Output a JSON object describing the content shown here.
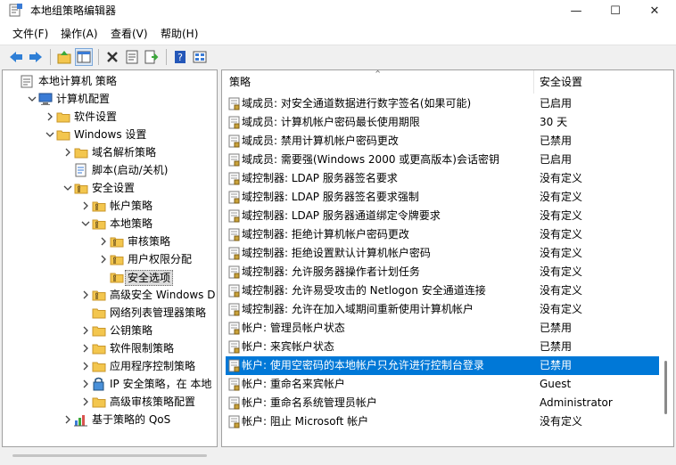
{
  "window": {
    "title": "本地组策略编辑器",
    "buttons": {
      "minimize": "—",
      "maximize": "☐",
      "close": "✕"
    }
  },
  "menu": [
    "文件(F)",
    "操作(A)",
    "查看(V)",
    "帮助(H)"
  ],
  "toolbar": [
    "back-icon",
    "forward-icon",
    "up-icon",
    "show-hide-tree-icon",
    "delete-icon",
    "properties-icon",
    "export-icon",
    "help-icon",
    "view-icon"
  ],
  "tree": [
    {
      "label": "本地计算机 策略",
      "level": 0,
      "icon": "computer-policy-icon",
      "expander": "none"
    },
    {
      "label": "计算机配置",
      "level": 1,
      "icon": "computer-icon",
      "expander": "open"
    },
    {
      "label": "软件设置",
      "level": 2,
      "icon": "folder-icon",
      "expander": "closed"
    },
    {
      "label": "Windows 设置",
      "level": 2,
      "icon": "folder-icon",
      "expander": "open"
    },
    {
      "label": "域名解析策略",
      "level": 3,
      "icon": "folder-icon",
      "expander": "closed"
    },
    {
      "label": "脚本(启动/关机)",
      "level": 3,
      "icon": "script-icon",
      "expander": "none"
    },
    {
      "label": "安全设置",
      "level": 3,
      "icon": "security-folder-icon",
      "expander": "open"
    },
    {
      "label": "帐户策略",
      "level": 4,
      "icon": "security-folder-icon",
      "expander": "closed"
    },
    {
      "label": "本地策略",
      "level": 4,
      "icon": "security-folder-icon",
      "expander": "open"
    },
    {
      "label": "审核策略",
      "level": 5,
      "icon": "security-folder-icon",
      "expander": "closed"
    },
    {
      "label": "用户权限分配",
      "level": 5,
      "icon": "security-folder-icon",
      "expander": "closed"
    },
    {
      "label": "安全选项",
      "level": 5,
      "icon": "security-folder-icon",
      "expander": "none",
      "selected": true
    },
    {
      "label": "高级安全 Windows D",
      "level": 4,
      "icon": "security-folder-icon",
      "expander": "closed"
    },
    {
      "label": "网络列表管理器策略",
      "level": 4,
      "icon": "folder-icon",
      "expander": "none"
    },
    {
      "label": "公钥策略",
      "level": 4,
      "icon": "folder-icon",
      "expander": "closed"
    },
    {
      "label": "软件限制策略",
      "level": 4,
      "icon": "folder-icon",
      "expander": "closed"
    },
    {
      "label": "应用程序控制策略",
      "level": 4,
      "icon": "folder-icon",
      "expander": "closed"
    },
    {
      "label": "IP 安全策略，在 本地",
      "level": 4,
      "icon": "ip-security-icon",
      "expander": "closed"
    },
    {
      "label": "高级审核策略配置",
      "level": 4,
      "icon": "folder-icon",
      "expander": "closed"
    },
    {
      "label": "基于策略的 QoS",
      "level": 3,
      "icon": "qos-chart-icon",
      "expander": "closed"
    }
  ],
  "list": {
    "columns": {
      "policy": "策略",
      "setting": "安全设置"
    },
    "rows": [
      {
        "name": "域成员: 对安全通道数据进行数字签名(如果可能)",
        "value": "已启用"
      },
      {
        "name": "域成员: 计算机帐户密码最长使用期限",
        "value": "30 天"
      },
      {
        "name": "域成员: 禁用计算机帐户密码更改",
        "value": "已禁用"
      },
      {
        "name": "域成员: 需要强(Windows 2000 或更高版本)会话密钥",
        "value": "已启用"
      },
      {
        "name": "域控制器: LDAP 服务器签名要求",
        "value": "没有定义"
      },
      {
        "name": "域控制器: LDAP 服务器签名要求强制",
        "value": "没有定义"
      },
      {
        "name": "域控制器: LDAP 服务器通道绑定令牌要求",
        "value": "没有定义"
      },
      {
        "name": "域控制器: 拒绝计算机帐户密码更改",
        "value": "没有定义"
      },
      {
        "name": "域控制器:  拒绝设置默认计算机帐户密码",
        "value": "没有定义"
      },
      {
        "name": "域控制器: 允许服务器操作者计划任务",
        "value": "没有定义"
      },
      {
        "name": "域控制器: 允许易受攻击的 Netlogon 安全通道连接",
        "value": "没有定义"
      },
      {
        "name": "域控制器:  允许在加入域期间重新使用计算机帐户",
        "value": "没有定义"
      },
      {
        "name": "帐户: 管理员帐户状态",
        "value": "已禁用"
      },
      {
        "name": "帐户: 来宾帐户状态",
        "value": "已禁用"
      },
      {
        "name": "帐户: 使用空密码的本地帐户只允许进行控制台登录",
        "value": "已禁用",
        "selected": true
      },
      {
        "name": "帐户: 重命名来宾帐户",
        "value": "Guest"
      },
      {
        "name": "帐户: 重命名系统管理员帐户",
        "value": "Administrator"
      },
      {
        "name": "帐户: 阻止 Microsoft 帐户",
        "value": "没有定义"
      }
    ]
  },
  "colors": {
    "selection": "#0078d7",
    "folder": "#f3c64e",
    "policy_icon_border": "#7d7d7d"
  }
}
